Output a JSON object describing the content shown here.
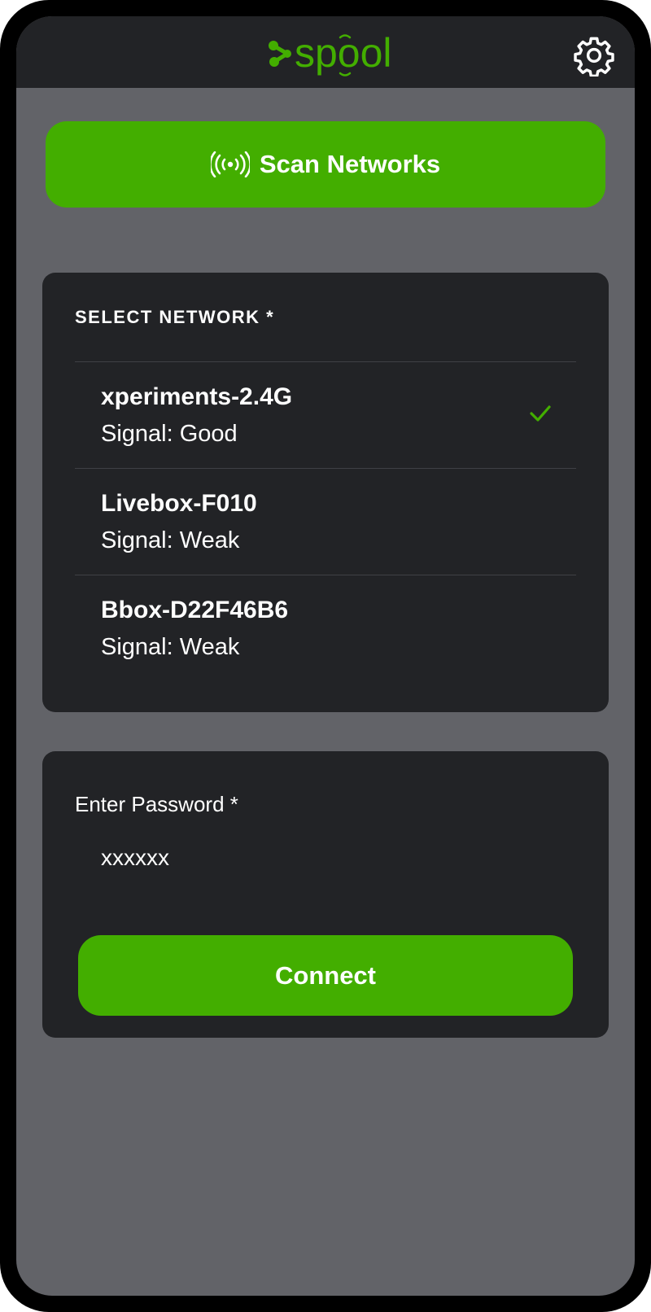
{
  "header": {
    "logo_text": "spool",
    "settings_icon": "gear-icon"
  },
  "scan": {
    "label": "Scan Networks",
    "icon": "broadcast-icon"
  },
  "network_section": {
    "title": "SELECT NETWORK *",
    "networks": [
      {
        "name": "xperiments-2.4G",
        "signal": "Signal: Good",
        "selected": true
      },
      {
        "name": "Livebox-F010",
        "signal": "Signal: Weak",
        "selected": false
      },
      {
        "name": "Bbox-D22F46B6",
        "signal": "Signal: Weak",
        "selected": false
      }
    ]
  },
  "password": {
    "label": "Enter Password *",
    "value": "xxxxxx"
  },
  "connect": {
    "label": "Connect"
  },
  "colors": {
    "accent": "#43ae00",
    "card_bg": "#222326",
    "screen_bg": "#626368"
  }
}
